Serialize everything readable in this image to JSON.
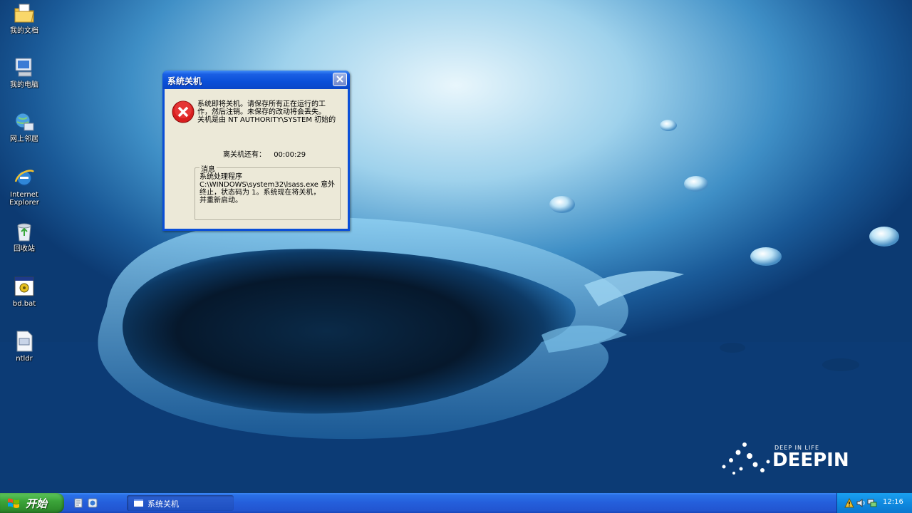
{
  "desktop": {
    "icons": [
      {
        "label": "我的文档",
        "icon": "my-documents-folder-icon"
      },
      {
        "label": "我的电脑",
        "icon": "my-computer-icon"
      },
      {
        "label": "网上邻居",
        "icon": "network-places-icon"
      },
      {
        "label": "Internet Explorer",
        "icon": "internet-explorer-icon"
      },
      {
        "label": "回收站",
        "icon": "recycle-bin-icon"
      },
      {
        "label": "bd.bat",
        "icon": "batch-file-icon"
      },
      {
        "label": "ntldr",
        "icon": "system-file-icon"
      }
    ],
    "wallpaper_brand": {
      "tagline": "DEEP IN LIFE",
      "name": "DEEPIN"
    }
  },
  "dialog": {
    "title": "系统关机",
    "icon": "error-icon",
    "message_lines": [
      "系统即将关机。请保存所有正在运行的工",
      "作，然后注销。未保存的改动将会丢失。",
      "关机是由 NT AUTHORITY\\SYSTEM 初始的"
    ],
    "countdown_label": "离关机还有：",
    "countdown_value": "00:00:29",
    "message_group": {
      "legend": "消息",
      "lines": [
        "系统处理程序",
        "C:\\WINDOWS\\system32\\lsass.exe 意外",
        "终止，状态码为 1。系统现在将关机，",
        "并重新启动。"
      ]
    }
  },
  "taskbar": {
    "start_label": "开始",
    "quick_launch": [
      "show-desktop-icon",
      "explorer-icon"
    ],
    "tasks": [
      {
        "label": "系统关机"
      }
    ],
    "tray_icons": [
      "warning-icon",
      "sound-icon",
      "network-icon"
    ],
    "clock": "12:16"
  },
  "colors": {
    "taskbar_blue": "#245edb",
    "start_green": "#3ca53a",
    "dialog_face": "#ece9d8",
    "title_blue": "#0a4fd8"
  }
}
